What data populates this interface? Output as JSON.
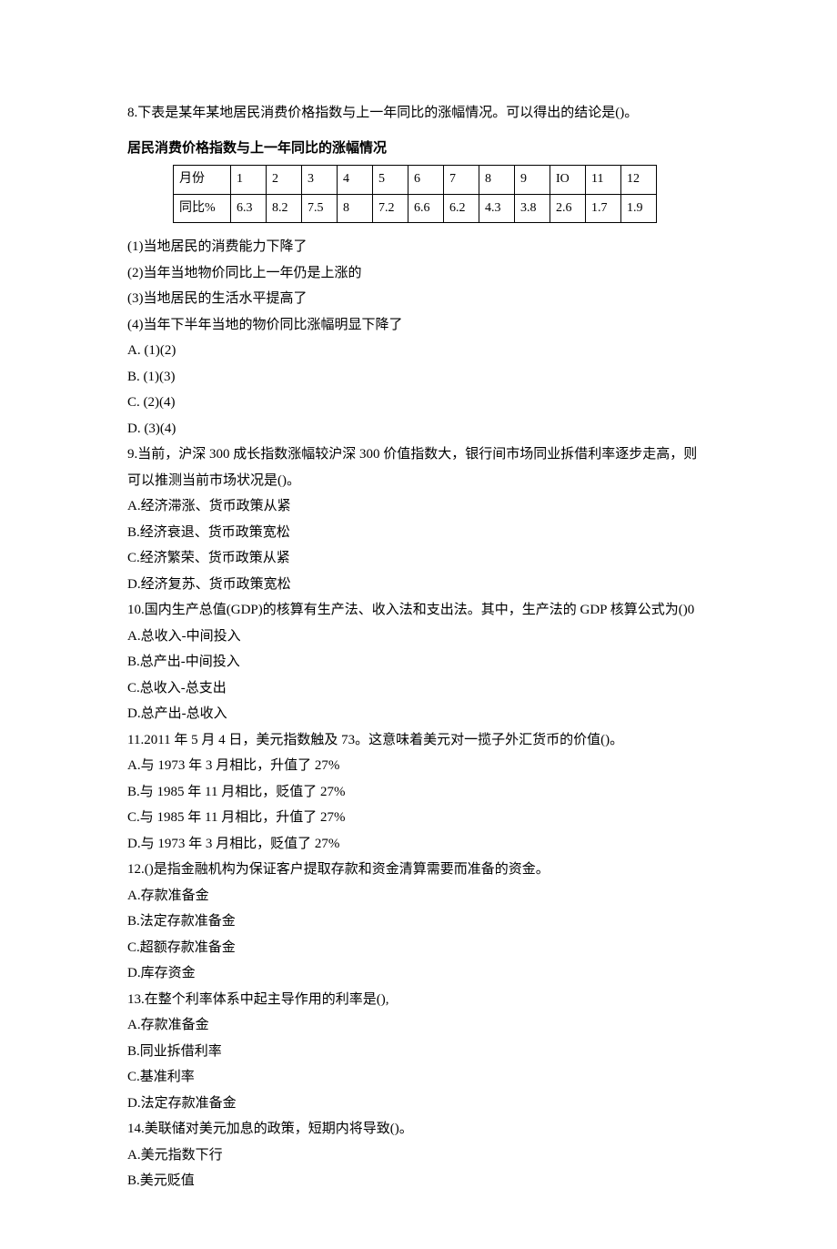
{
  "q8": {
    "stem": "8.下表是某年某地居民消费价格指数与上一年同比的涨幅情况。可以得出的结论是()。",
    "caption": "居民消费价格指数与上一年同比的涨幅情况",
    "row1label": "月份",
    "row2label": "同比%",
    "s1": "(1)当地居民的消费能力下降了",
    "s2": "(2)当年当地物价同比上一年仍是上涨的",
    "s3": "(3)当地居民的生活水平提高了",
    "s4": "(4)当年下半年当地的物价同比涨幅明显下降了",
    "a": "A.  (1)(2)",
    "b": "B.  (1)(3)",
    "c": "C.  (2)(4)",
    "d": "D.  (3)(4)"
  },
  "chart_data": {
    "type": "table",
    "title": "居民消费价格指数与上一年同比的涨幅情况",
    "categories": [
      "1",
      "2",
      "3",
      "4",
      "5",
      "6",
      "7",
      "8",
      "9",
      "IO",
      "11",
      "12"
    ],
    "series": [
      {
        "name": "同比%",
        "values": [
          6.3,
          8.2,
          7.5,
          8.0,
          7.2,
          6.6,
          6.2,
          4.3,
          3.8,
          2.6,
          1.7,
          1.9
        ]
      }
    ],
    "xlabel": "月份",
    "ylabel": "同比%"
  },
  "q9": {
    "stem": "9.当前，沪深 300 成长指数涨幅较沪深 300 价值指数大，银行间市场同业拆借利率逐步走高，则可以推测当前市场状况是()。",
    "a": "A.经济滞涨、货币政策从紧",
    "b": "B.经济衰退、货币政策宽松",
    "c": "C.经济繁荣、货币政策从紧",
    "d": "D.经济复苏、货币政策宽松"
  },
  "q10": {
    "stem": "10.国内生产总值(GDP)的核算有生产法、收入法和支出法。其中，生产法的 GDP 核算公式为()0",
    "a": "A.总收入-中间投入",
    "b": "B.总产出-中间投入",
    "c": "C.总收入-总支出",
    "d": "D.总产出-总收入"
  },
  "q11": {
    "stem": "11.2011 年 5 月 4 日，美元指数触及 73。这意味着美元对一揽子外汇货币的价值()。",
    "a": "A.与 1973 年 3 月相比，升值了 27%",
    "b": "B.与 1985 年 11 月相比，贬值了 27%",
    "c": "C.与 1985 年 11 月相比，升值了 27%",
    "d": "D.与 1973 年 3 月相比，贬值了 27%"
  },
  "q12": {
    "stem": "12.()是指金融机构为保证客户提取存款和资金清算需要而准备的资金。",
    "a": "A.存款准备金",
    "b": "B.法定存款准备金",
    "c": "C.超额存款准备金",
    "d": "D.库存资金"
  },
  "q13": {
    "stem": "13.在整个利率体系中起主导作用的利率是(),",
    "a": "A.存款准备金",
    "b": "B.同业拆借利率",
    "c": "C.基准利率",
    "d": "D.法定存款准备金"
  },
  "q14": {
    "stem": "14.美联储对美元加息的政策，短期内将导致()。",
    "a": "A.美元指数下行",
    "b": "B.美元贬值"
  }
}
